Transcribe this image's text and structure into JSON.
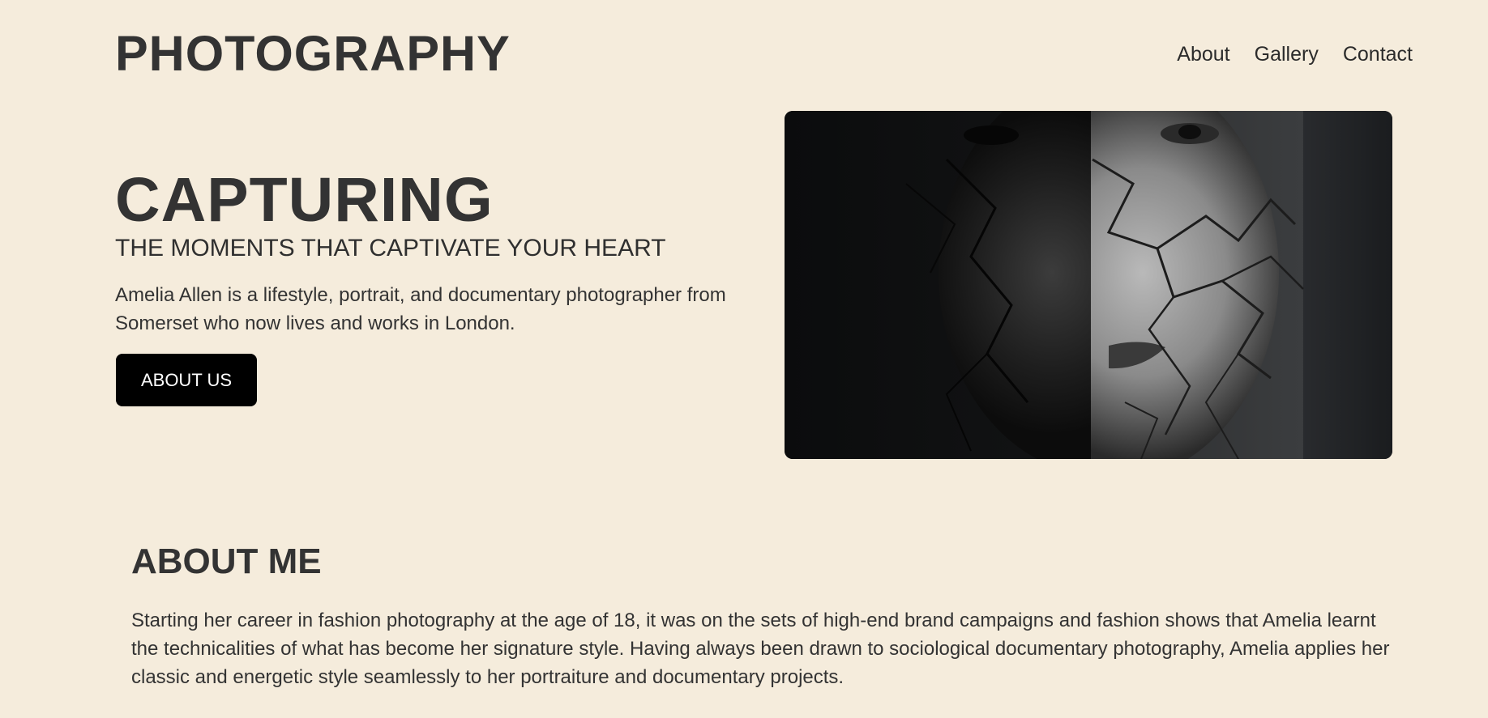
{
  "header": {
    "logo": "PHOTOGRAPHY",
    "nav": [
      "About",
      "Gallery",
      "Contact"
    ]
  },
  "hero": {
    "title": "CAPTURING",
    "subtitle": "THE MOMENTS THAT CAPTIVATE YOUR HEART",
    "description": "Amelia Allen is a lifestyle, portrait, and documentary photographer from Somerset who now lives and works in London.",
    "button_label": "ABOUT US",
    "image": "portrait-photo"
  },
  "about": {
    "heading": "ABOUT ME",
    "text": "Starting her career in fashion photography at the age of 18, it was on the sets of high-end brand campaigns and fashion shows that Amelia learnt the technicalities of what has become her signature style. Having always been drawn to sociological documentary photography, Amelia applies her classic and energetic style seamlessly to her portraiture and documentary projects."
  },
  "colors": {
    "background": "#f5ecdc",
    "text": "#333333",
    "button": "#000000"
  }
}
